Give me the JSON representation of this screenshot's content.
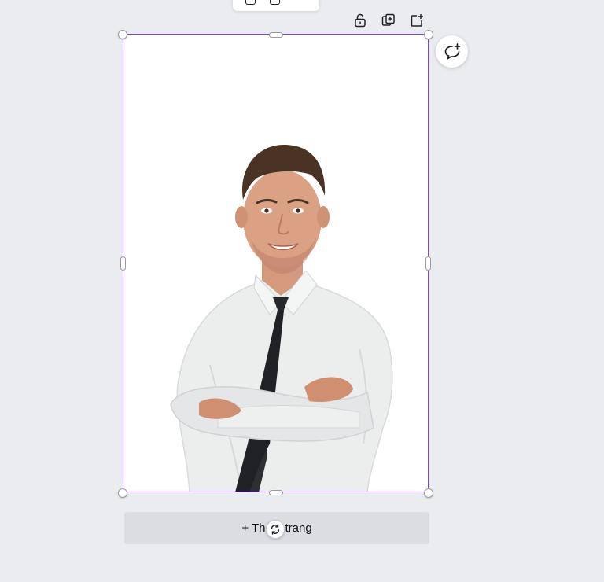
{
  "toolbar": {
    "icons": [
      "lock-icon",
      "duplicate-page-icon",
      "add-page-icon"
    ]
  },
  "comment": {
    "icon": "add-comment-icon"
  },
  "canvas": {
    "page_background": "#ffffff",
    "selection_color": "#8b3dff",
    "photo": "man-in-white-shirt-and-black-tie-with-crossed-arms"
  },
  "add_page": {
    "label": "+ Thêm trang"
  },
  "rotate": {
    "icon": "rotate-icon"
  }
}
